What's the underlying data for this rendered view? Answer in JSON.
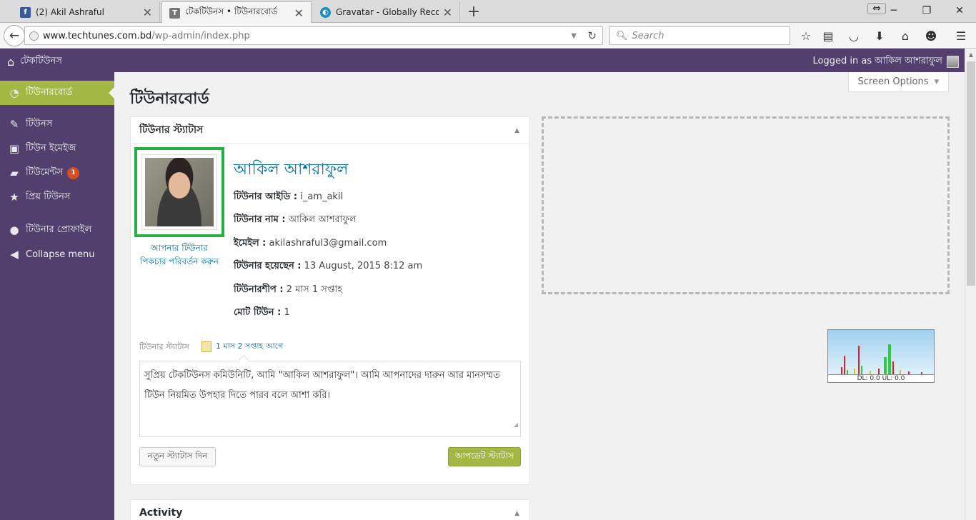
{
  "browser": {
    "tabs": [
      {
        "title": "(2) Akil Ashraful",
        "favicon": "facebook-icon"
      },
      {
        "title": "টেকটিউনস • টিউনারবোর্ড",
        "favicon": "techtunes-icon"
      },
      {
        "title": "Gravatar - Globally Recog...",
        "favicon": "gravatar-icon"
      }
    ],
    "url_host": "www.techtunes.com.bd",
    "url_path": "/wp-admin/index.php",
    "search_placeholder": "Search"
  },
  "adminbar": {
    "site_name": "টেকটিউনস",
    "logged_in_text": "Logged in as আকিল আশরাফুল"
  },
  "sidebar": {
    "items": [
      {
        "label": "টিউনারবোর্ড",
        "icon": "dashboard-icon",
        "current": true
      },
      {
        "label": "টিউনস",
        "icon": "pin-icon"
      },
      {
        "label": "টিউন ইমেইজ",
        "icon": "media-icon"
      },
      {
        "label": "টিউমেন্টস",
        "icon": "comment-icon",
        "badge": "1"
      },
      {
        "label": "প্রিয় টিউনস",
        "icon": "star-icon"
      },
      {
        "label": "টিউনার প্রোফাইল",
        "icon": "user-icon"
      },
      {
        "label": "Collapse menu",
        "icon": "collapse-icon"
      }
    ]
  },
  "main": {
    "page_title": "টিউনারবোর্ড",
    "screen_options": "Screen Options",
    "status_box": {
      "title": "টিউনার স্ট্যাটাস",
      "change_picture_link": "আপনার টিউনার পিকচার পরিবর্তন করুন",
      "name": "আকিল আশরাফুল",
      "fields": [
        {
          "label": "টিউনার আইডি :",
          "value": "i_am_akil"
        },
        {
          "label": "টিউনার নাম :",
          "value": "আকিল আশরাফুল"
        },
        {
          "label": "ইমেইল :",
          "value": "akilashraful3@gmail.com"
        },
        {
          "label": "টিউনার হয়েছেন :",
          "value": "13 August, 2015 8:12 am"
        },
        {
          "label": "টিউনারশীপ :",
          "value": "2 মাস 1 সপ্তাহ"
        },
        {
          "label": "মোট টিউন :",
          "value": "1"
        }
      ],
      "status_label": "টিউনার স্ট্যাটাস",
      "status_time": "1 মাস 2 সপ্তাহ আগে",
      "status_text": "সুপ্রিয় টেকটিউনস কমিউনিটি, আমি \"আকিল আশরাফুল\"। আমি আপনাদের দারুন আর মানসম্মত টিউন নিয়মিত উপহার দিতে পারব বলে আশা করি।",
      "new_status_button": "নতুন স্ট্যাটাস দিন",
      "update_status_button": "আপডেট স্ট্যাটাস"
    },
    "activity_box": {
      "title": "Activity"
    },
    "net_monitor": {
      "label": "DL: 0.0 UL: 0.0"
    }
  },
  "colors": {
    "admin_purple": "#523f6d",
    "accent_green": "#a3b745",
    "avatar_frame_green": "#25b043",
    "link_blue": "#0073aa"
  }
}
